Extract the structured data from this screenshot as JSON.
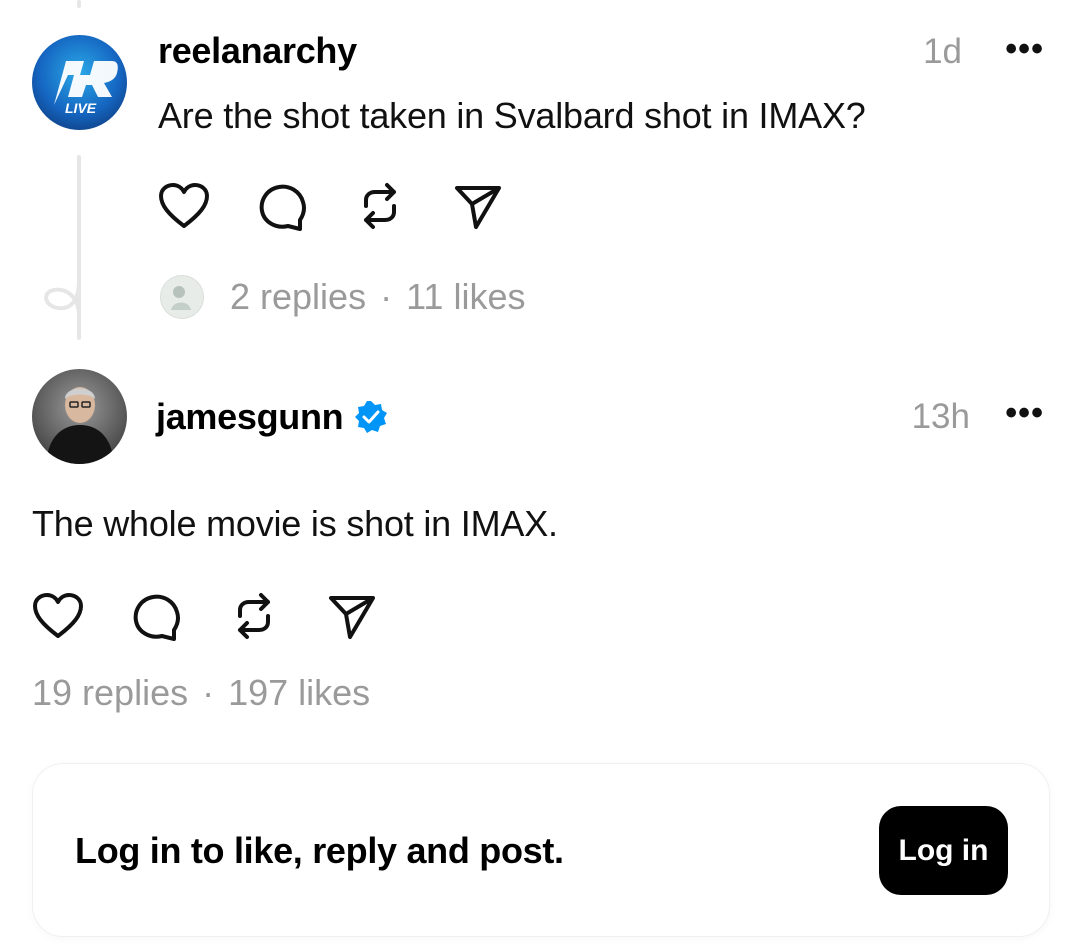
{
  "posts": [
    {
      "username": "reelanarchy",
      "time": "1d",
      "more": "•••",
      "text": "Are the shot taken in Svalbard shot in IMAX?",
      "replies": "2 replies",
      "separator": "·",
      "likes": "11 likes",
      "avatar_text": "LIVE"
    },
    {
      "username": "jamesgunn",
      "verified": true,
      "time": "13h",
      "more": "•••",
      "text": "The whole movie is shot in IMAX.",
      "replies": "19 replies",
      "separator": "·",
      "likes": "197 likes"
    }
  ],
  "icons": [
    "heart-icon",
    "comment-icon",
    "repost-icon",
    "share-icon"
  ],
  "login_prompt": {
    "text": "Log in to like, reply and post.",
    "button": "Log in"
  },
  "colors": {
    "verified": "#0095f6",
    "muted": "#9a9a9a",
    "button_bg": "#000000"
  }
}
